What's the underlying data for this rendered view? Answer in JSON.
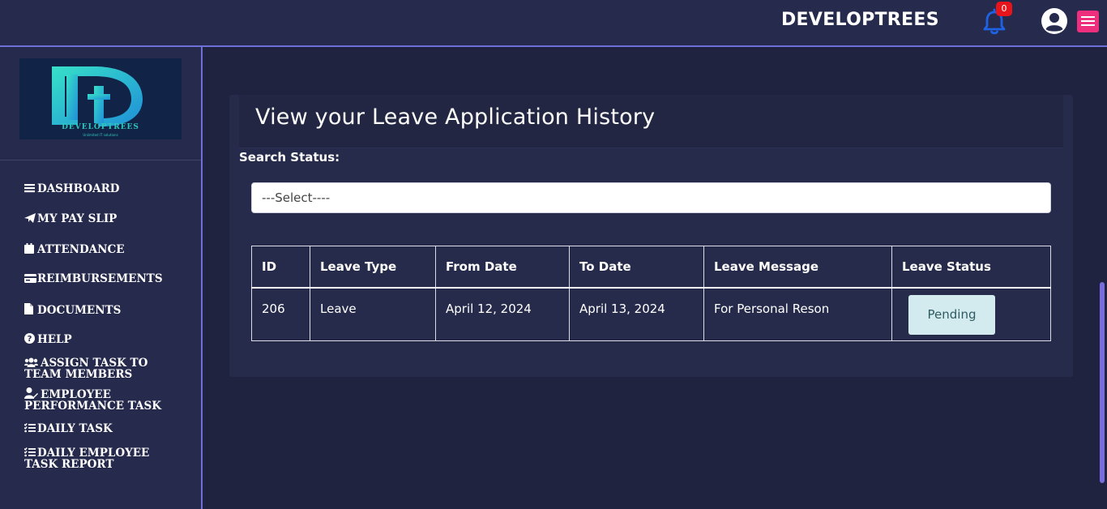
{
  "header": {
    "brand": "DEVELOPTREES",
    "notification_count": "0"
  },
  "sidebar": {
    "logo": {
      "letters": "Dt",
      "name": "DEVELOPTREES",
      "tagline": "Unlimited IT solutions"
    },
    "items": [
      {
        "label": "DASHBOARD",
        "icon": "bars-icon"
      },
      {
        "label": "MY PAY SLIP",
        "icon": "paper-plane-icon"
      },
      {
        "label": "ATTENDANCE",
        "icon": "calendar-icon"
      },
      {
        "label": "REIMBURSEMENTS",
        "icon": "credit-card-icon"
      },
      {
        "label": "DOCUMENTS",
        "icon": "document-icon"
      },
      {
        "label": "HELP",
        "icon": "question-circle-icon"
      },
      {
        "label": "ASSIGN TASK TO TEAM MEMBERS",
        "icon": "users-icon"
      },
      {
        "label": "EMPLOYEE PERFORMANCE TASK",
        "icon": "user-edit-icon"
      },
      {
        "label": "DAILY TASK",
        "icon": "list-check-icon"
      },
      {
        "label": "DAILY EMPLOYEE TASK REPORT",
        "icon": "list-check-icon"
      }
    ]
  },
  "main": {
    "title": "View your Leave Application History",
    "search_label": "Search Status:",
    "select_value": "---Select----",
    "table": {
      "headers": [
        "ID",
        "Leave Type",
        "From Date",
        "To Date",
        "Leave Message",
        "Leave Status"
      ],
      "rows": [
        [
          "206",
          "Leave",
          "April 12, 2024",
          "April 13, 2024",
          "For Personal Reson",
          "Pending"
        ]
      ]
    }
  },
  "colors": {
    "background": "#20233f",
    "panel": "#262a4c",
    "accent_border": "#6f6fd8",
    "bell": "#1e63e6",
    "badge": "#e8141c",
    "menu_button": "#ed2f7e",
    "pending_bg": "#d3ebef",
    "scrollbar": "#7a6be0"
  }
}
